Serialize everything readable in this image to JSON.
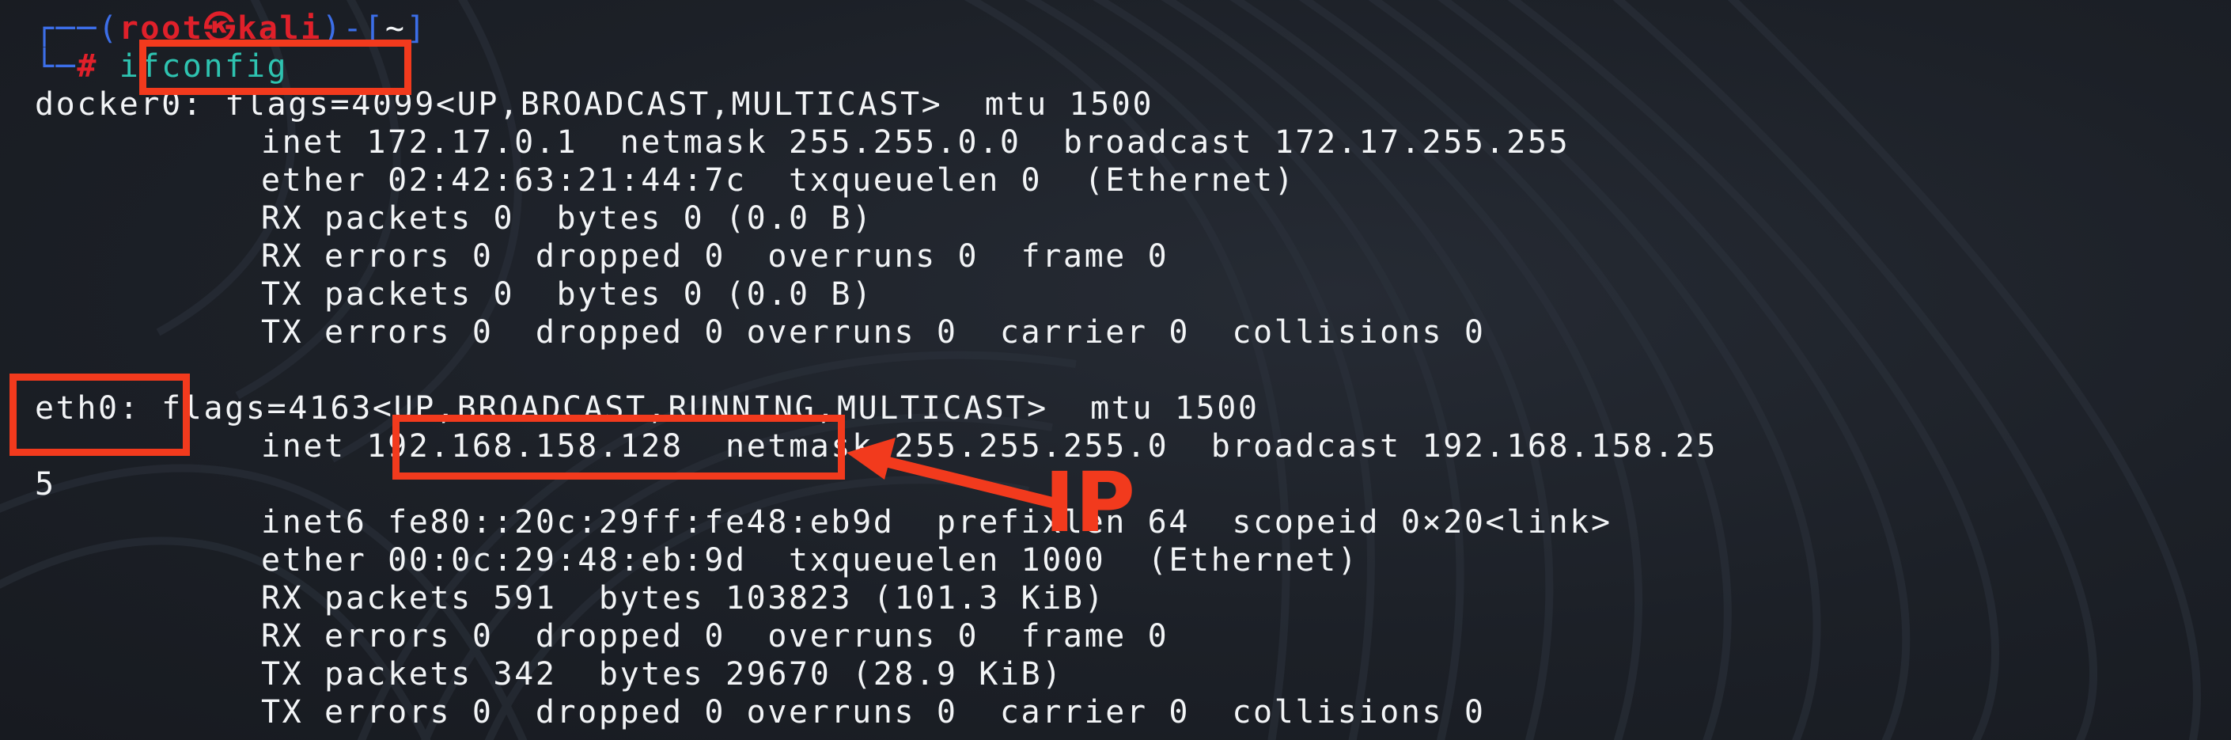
{
  "prompt": {
    "corner_top": "┌──(",
    "user": "root",
    "at_symbol": "㉿",
    "host": "kali",
    "mid": ")-[",
    "dir": "~",
    "end": "]",
    "corner_bottom": "└─",
    "symbol": "#",
    "command": "ifconfig"
  },
  "docker0": {
    "header_name": "docker0:",
    "header_rest": " flags=4099<UP,BROADCAST,MULTICAST>  mtu 1500",
    "lines": [
      "inet 172.17.0.1  netmask 255.255.0.0  broadcast 172.17.255.255",
      "ether 02:42:63:21:44:7c  txqueuelen 0  (Ethernet)",
      "RX packets 0  bytes 0 (0.0 B)",
      "RX errors 0  dropped 0  overruns 0  frame 0",
      "TX packets 0  bytes 0 (0.0 B)",
      "TX errors 0  dropped 0 overruns 0  carrier 0  collisions 0"
    ]
  },
  "eth0": {
    "header_name": "eth0:",
    "header_rest": " flags=4163<UP,BROADCAST,RUNNING,MULTICAST>  mtu 1500",
    "inet_label": "inet ",
    "inet_addr": "192.168.158.128",
    "inet_rest": "  netmask 255.255.255.0  broadcast 192.168.158.25",
    "wrap": "5",
    "lines": [
      "inet6 fe80::20c:29ff:fe48:eb9d  prefixlen 64  scopeid 0×20<link>",
      "ether 00:0c:29:48:eb:9d  txqueuelen 1000  (Ethernet)",
      "RX packets 591  bytes 103823 (101.3 KiB)",
      "RX errors 0  dropped 0  overruns 0  frame 0",
      "TX packets 342  bytes 29670 (28.9 KiB)",
      "TX errors 0  dropped 0 overruns 0  carrier 0  collisions 0"
    ]
  },
  "annotation": {
    "label": "IP",
    "color": "#f23a1d"
  },
  "colors": {
    "background": "#1c2027",
    "text": "#f2f4f6",
    "prompt_frame": "#3c6ee8",
    "prompt_user": "#e0202a",
    "command": "#2ec3b0"
  }
}
